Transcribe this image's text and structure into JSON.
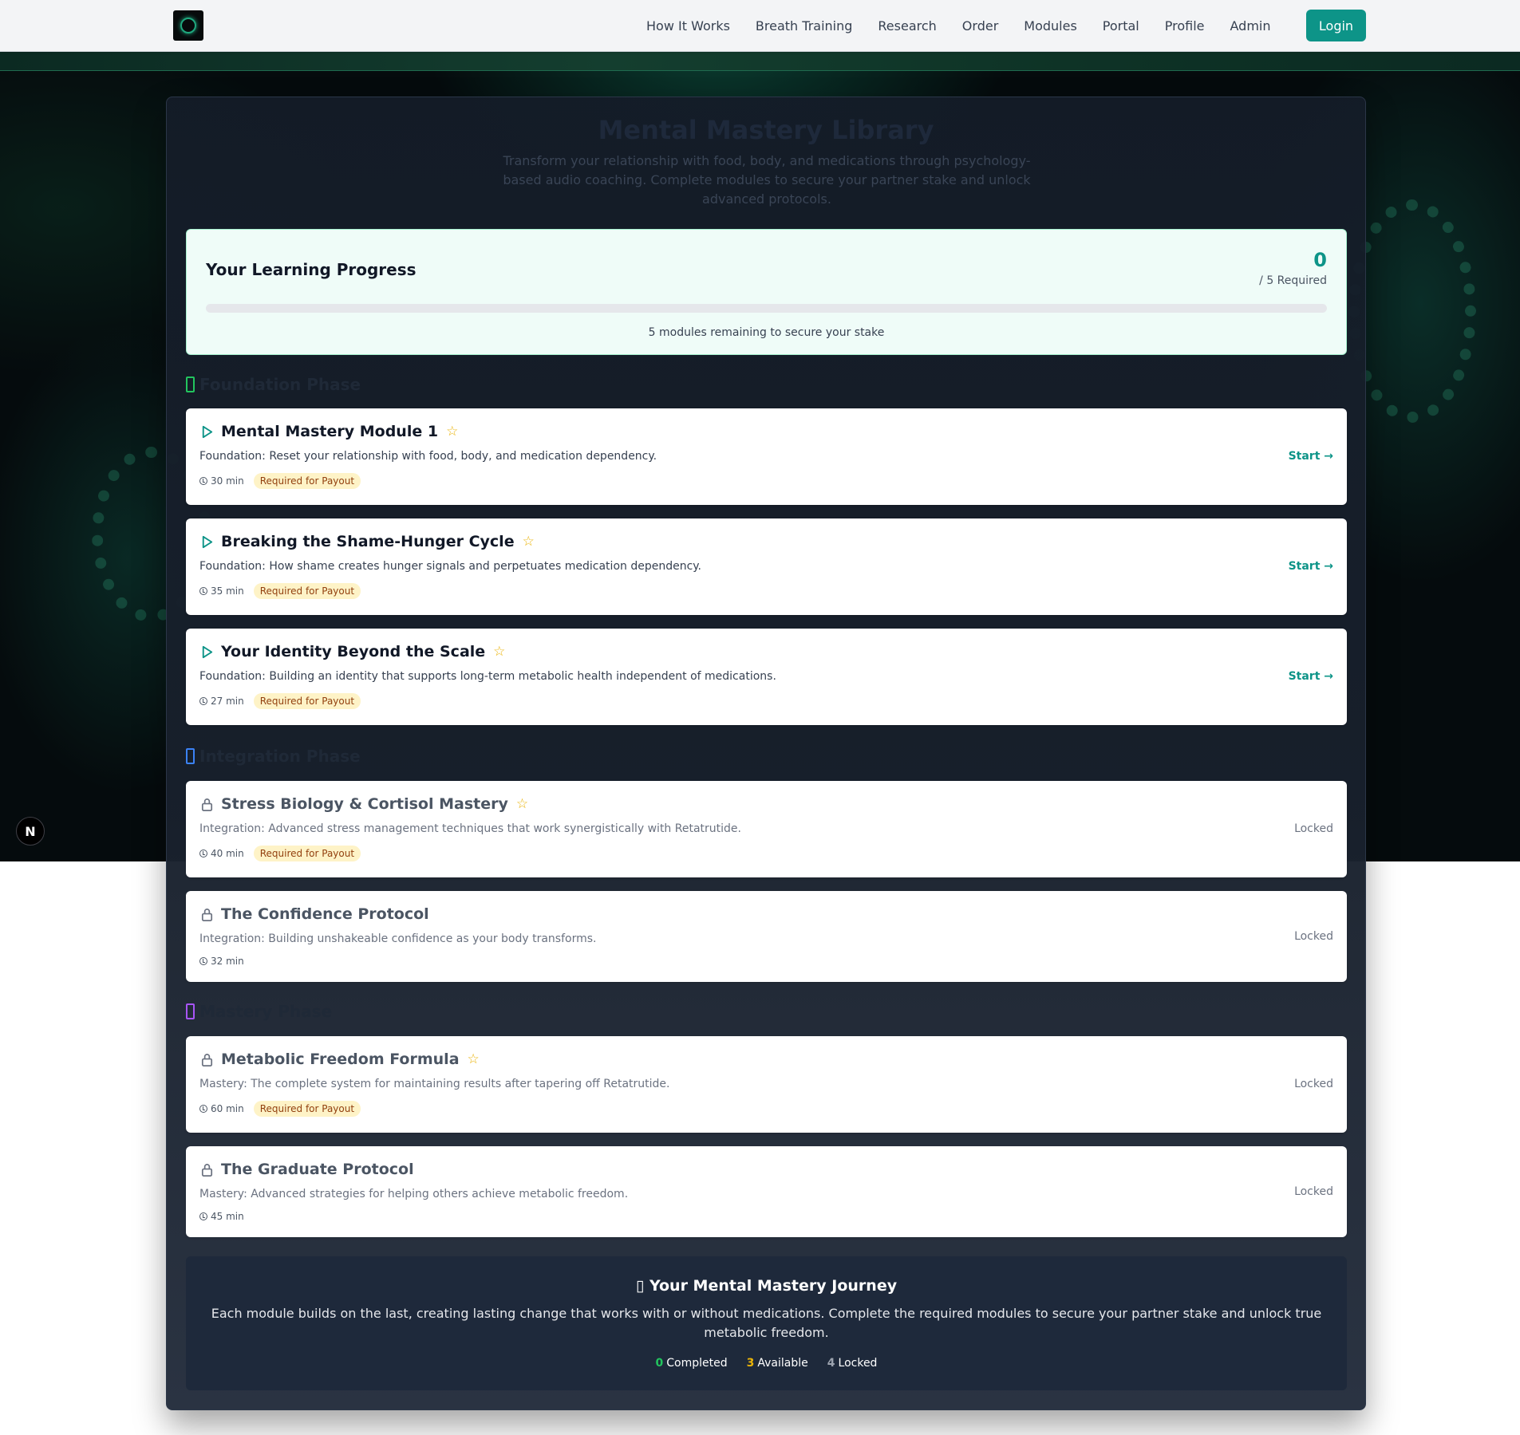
{
  "nav": {
    "links": [
      "How It Works",
      "Breath Training",
      "Research",
      "Order",
      "Modules",
      "Portal",
      "Profile",
      "Admin"
    ],
    "login_label": "Login",
    "logo_icon": "brain-logo-icon"
  },
  "colors": {
    "accent": "#0d9488",
    "badge_bg": "#fef3c7",
    "foundation": "#22c55e",
    "integration": "#3b82f6",
    "mastery": "#a855f7",
    "star": "#eab308"
  },
  "library": {
    "title": "Mental Mastery Library",
    "subtitle": "Transform your relationship with food, body, and medications through psychology-based audio coaching. Complete modules to secure your partner stake and unlock advanced protocols."
  },
  "progress": {
    "title": "Your Learning Progress",
    "count": "0",
    "required": "/ 5 Required",
    "fraction": 0,
    "note": "5 modules remaining to secure your stake"
  },
  "phases": [
    {
      "title": "Foundation Phase",
      "modules": [
        {
          "title": "Mental Mastery Module 1",
          "desc": "Foundation: Reset your relationship with food, body, and medication dependency.",
          "duration": "30 min",
          "badge": "Required for Payout",
          "action": "Start →"
        },
        {
          "title": "Breaking the Shame-Hunger Cycle",
          "desc": "Foundation: How shame creates hunger signals and perpetuates medication dependency.",
          "duration": "35 min",
          "badge": "Required for Payout",
          "action": "Start →"
        },
        {
          "title": "Your Identity Beyond the Scale",
          "desc": "Foundation: Building an identity that supports long-term metabolic health independent of medications.",
          "duration": "27 min",
          "badge": "Required for Payout",
          "action": "Start →"
        }
      ]
    },
    {
      "title": "Integration Phase",
      "modules": [
        {
          "title": "Stress Biology & Cortisol Mastery",
          "desc": "Integration: Advanced stress management techniques that work synergistically with Retatrutide.",
          "duration": "40 min",
          "badge": "Required for Payout",
          "status": "Locked"
        },
        {
          "title": "The Confidence Protocol",
          "desc": "Integration: Building unshakeable confidence as your body transforms.",
          "duration": "32 min",
          "status": "Locked"
        }
      ]
    },
    {
      "title": "Mastery Phase",
      "modules": [
        {
          "title": "Metabolic Freedom Formula",
          "desc": "Mastery: The complete system for maintaining results after tapering off Retatrutide.",
          "duration": "60 min",
          "badge": "Required for Payout",
          "status": "Locked"
        },
        {
          "title": "The Graduate Protocol",
          "desc": "Mastery: Advanced strategies for helping others achieve metabolic freedom.",
          "duration": "45 min",
          "status": "Locked"
        }
      ]
    }
  ],
  "journey": {
    "title": "Your Mental Mastery Journey",
    "text": "Each module builds on the last, creating lasting change that works with or without medications. Complete the required modules to secure your partner stake and unlock true metabolic freedom.",
    "stats": [
      {
        "value": "0",
        "label": "Completed",
        "color": "#22c55e"
      },
      {
        "value": "3",
        "label": "Available",
        "color": "#eab308"
      },
      {
        "value": "4",
        "label": "Locked",
        "color": "#9ca3af"
      }
    ]
  },
  "dev_badge": "N"
}
